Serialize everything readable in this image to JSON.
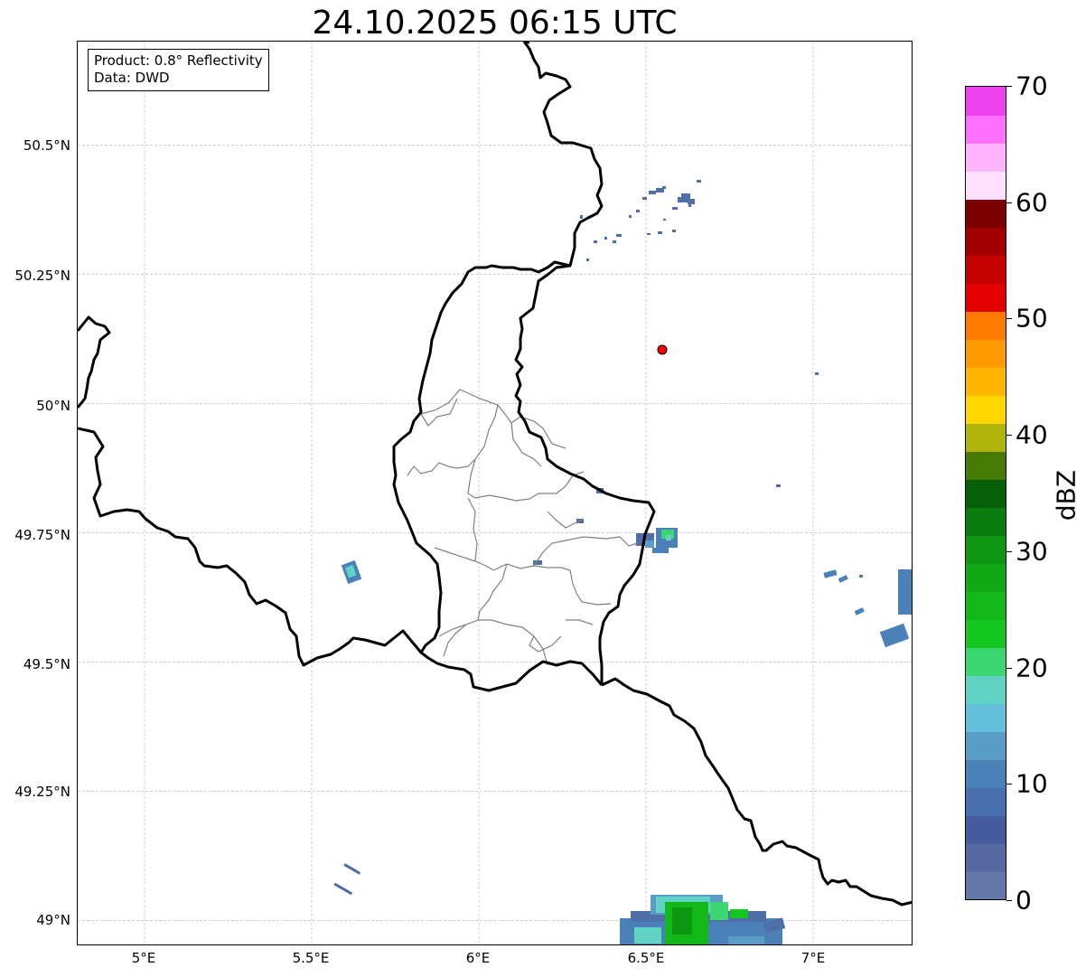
{
  "title": "24.10.2025 06:15 UTC",
  "info": {
    "product": "Product: 0.8° Reflectivity",
    "source": "Data: DWD"
  },
  "map": {
    "lon_range": [
      4.8,
      7.3
    ],
    "lat_range": [
      48.95,
      50.7
    ],
    "x_ticks": [
      {
        "value": 5.0,
        "label": "5°E"
      },
      {
        "value": 5.5,
        "label": "5.5°E"
      },
      {
        "value": 6.0,
        "label": "6°E"
      },
      {
        "value": 6.5,
        "label": "6.5°E"
      },
      {
        "value": 7.0,
        "label": "7°E"
      }
    ],
    "y_ticks": [
      {
        "value": 49.0,
        "label": "49°N"
      },
      {
        "value": 49.25,
        "label": "49.25°N"
      },
      {
        "value": 49.5,
        "label": "49.5°N"
      },
      {
        "value": 49.75,
        "label": "49.75°N"
      },
      {
        "value": 50.0,
        "label": "50°N"
      },
      {
        "value": 50.25,
        "label": "50.25°N"
      },
      {
        "value": 50.5,
        "label": "50.5°N"
      }
    ],
    "radar_site": {
      "lon": 6.548,
      "lat": 50.11,
      "color": "#ff0000"
    },
    "country_border_color": "#000000",
    "district_border_color": "#808080"
  },
  "colorbar": {
    "label": "dBZ",
    "min": 0,
    "max": 70,
    "ticks": [
      0,
      10,
      20,
      30,
      40,
      50,
      60,
      70
    ],
    "colors": [
      "#6576a8",
      "#5868a0",
      "#465c9e",
      "#4a6fae",
      "#4c80b8",
      "#5a9ec8",
      "#64bfda",
      "#60d3c4",
      "#3cd672",
      "#14c820",
      "#12b81a",
      "#10a816",
      "#0e9812",
      "#0a7c10",
      "#075f0a",
      "#487a08",
      "#b0b40a",
      "#ffd800",
      "#ffb600",
      "#ff9a00",
      "#ff7a00",
      "#e40000",
      "#c40000",
      "#a20000",
      "#7c0000",
      "#ffe0ff",
      "#ffb4ff",
      "#ff70ff",
      "#ec40ec"
    ]
  }
}
